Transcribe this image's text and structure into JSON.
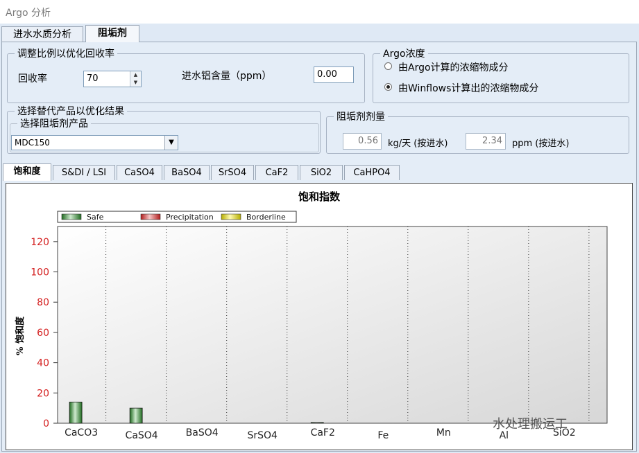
{
  "window": {
    "title": "Argo 分析"
  },
  "main_tabs": [
    {
      "label": "进水水质分析",
      "active": false
    },
    {
      "label": "阻垢剂",
      "active": true
    }
  ],
  "recovery_group": {
    "legend": "调整比例以优化回收率",
    "recovery_label": "回收率",
    "recovery_value": "70",
    "aluminum_label": "进水铝含量（ppm）",
    "aluminum_value": "0.00"
  },
  "argo_conc_group": {
    "legend": "Argo浓度",
    "options": [
      {
        "label": "由Argo计算的浓缩物成分",
        "selected": false
      },
      {
        "label": "由Winflows计算出的浓缩物成分",
        "selected": true
      }
    ]
  },
  "product_group": {
    "legend": "选择替代产品以优化结果",
    "sub_legend": "选择阻垢剂产品",
    "selected_product": "MDC150"
  },
  "dose_group": {
    "legend": "阻垢剂剂量",
    "kg_value": "0.56",
    "kg_unit": "kg/天 (按进水)",
    "ppm_value": "2.34",
    "ppm_unit": "ppm (按进水)"
  },
  "sub_tabs": [
    {
      "label": "饱和度",
      "active": true
    },
    {
      "label": "S&DI / LSI",
      "active": false
    },
    {
      "label": "CaSO4",
      "active": false
    },
    {
      "label": "BaSO4",
      "active": false
    },
    {
      "label": "SrSO4",
      "active": false
    },
    {
      "label": "CaF2",
      "active": false
    },
    {
      "label": "SiO2",
      "active": false
    },
    {
      "label": "CaHPO4",
      "active": false
    }
  ],
  "chart_data": {
    "type": "bar",
    "title": "饱和指数",
    "ylabel": "% 饱和度",
    "xlabel": "",
    "ylim": [
      0,
      130
    ],
    "yticks": [
      0,
      20,
      40,
      60,
      80,
      100,
      120
    ],
    "categories": [
      "CaCO3",
      "CaSO4",
      "BaSO4",
      "SrSO4",
      "CaF2",
      "Fe",
      "Mn",
      "Al",
      "SiO2"
    ],
    "series": [
      {
        "name": "Safe",
        "color": "#2e8b2e",
        "values": [
          14,
          10,
          0,
          0,
          0.5,
          0,
          0,
          0,
          0
        ]
      },
      {
        "name": "Precipitation",
        "color": "#e03030",
        "values": [
          0,
          0,
          0,
          0,
          0,
          0,
          0,
          0,
          0
        ]
      },
      {
        "name": "Borderline",
        "color": "#e8e020",
        "values": [
          0,
          0,
          0,
          0,
          0,
          0,
          0,
          0,
          0
        ]
      }
    ],
    "legend_position": "top-left",
    "grid": true
  },
  "watermark": "水处理搬运工"
}
